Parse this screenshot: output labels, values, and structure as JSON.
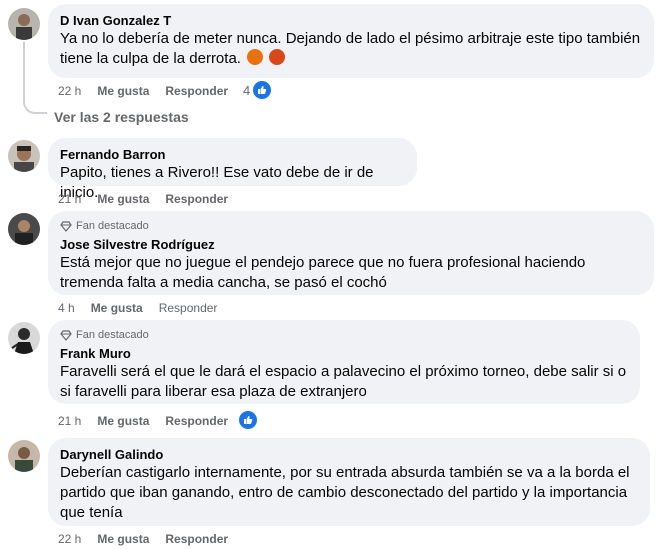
{
  "comments": [
    {
      "author": "D Ivan Gonzalez T",
      "text": "Ya no lo debería de meter nunca. Dejando de lado el pésimo arbitraje este tipo también tiene la culpa de la derrota.",
      "time": "22 h",
      "like_label": "Me gusta",
      "reply_label": "Responder",
      "reaction_count": "4"
    },
    {
      "author": "Fernando Barron",
      "text": "Papito, tienes a Rivero!! Ese vato debe de ir de inicio.",
      "time": "21 h",
      "like_label": "Me gusta",
      "reply_label": "Responder"
    },
    {
      "badge": "Fan destacado",
      "author": "Jose Silvestre Rodríguez",
      "text": "Está mejor que no juegue el pendejo parece que no fuera profesional haciendo tremenda falta a media cancha, se pasó el cochó",
      "time": "4 h",
      "like_label": "Me gusta",
      "reply_label": "Responder"
    },
    {
      "badge": "Fan destacado",
      "author": "Frank Muro",
      "text": "Faravelli será el que le dará el espacio a palavecino el próximo torneo, debe salir si o si faravelli para liberar esa plaza de extranjero",
      "time": "21 h",
      "like_label": "Me gusta",
      "reply_label": "Responder"
    },
    {
      "author": "Darynell Galindo",
      "text": "Deberían castigarlo internamente, por su entrada absurda también se va a la borda el partido que iban ganando, entro de cambio desconectado del partido y la importancia que tenía",
      "time": "22 h",
      "like_label": "Me gusta",
      "reply_label": "Responder"
    }
  ],
  "view_replies": "Ver las 2 respuestas",
  "colors": {
    "bubble": "#f0f2f5",
    "secondary_text": "#65676b",
    "like_blue": "#1b74e4",
    "angry": "#e9710f"
  }
}
